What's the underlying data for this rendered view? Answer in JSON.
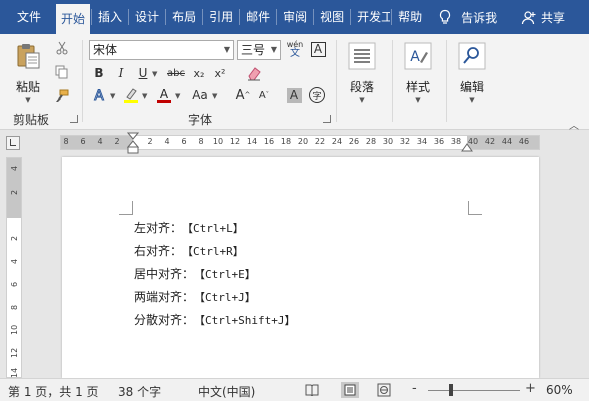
{
  "tabs": [
    {
      "label": "文件"
    },
    {
      "label": "开始",
      "active": true
    },
    {
      "label": "插入"
    },
    {
      "label": "设计"
    },
    {
      "label": "布局"
    },
    {
      "label": "引用"
    },
    {
      "label": "邮件"
    },
    {
      "label": "审阅"
    },
    {
      "label": "视图"
    },
    {
      "label": "开发工"
    },
    {
      "label": "帮助"
    }
  ],
  "tell_me": "告诉我",
  "share": "共享",
  "ribbon": {
    "clipboard": {
      "paste_label": "粘贴",
      "group_label": "剪贴板"
    },
    "font": {
      "font_name": "宋体",
      "font_size": "三号",
      "phonetic_char": "wén",
      "phonetic_sub": "文",
      "border_char": "A",
      "bold": "B",
      "italic": "I",
      "underline": "U",
      "strike": "abc",
      "subscript": "x₂",
      "superscript": "x²",
      "case_label": "Aa",
      "grow": "A",
      "shrink": "A",
      "shade_char": "A",
      "enclose_char": "字",
      "group_label": "字体"
    },
    "paragraph": {
      "label": "段落"
    },
    "styles": {
      "label": "样式"
    },
    "editing": {
      "label": "编辑"
    }
  },
  "ruler": {
    "left_labels": [
      "8",
      "6",
      "4",
      "2"
    ],
    "right_labels": [
      "2",
      "4",
      "6",
      "8",
      "10",
      "12",
      "14",
      "16",
      "18",
      "20",
      "22",
      "24",
      "26",
      "28",
      "30",
      "32",
      "34",
      "36",
      "38",
      "40",
      "42",
      "44",
      "46"
    ],
    "vertical_labels": [
      "4",
      "2",
      "2",
      "4",
      "6",
      "8",
      "10",
      "12",
      "14"
    ]
  },
  "document": {
    "lines": [
      {
        "label": "左对齐：",
        "key": "【Ctrl+L】"
      },
      {
        "label": "右对齐：",
        "key": "【Ctrl+R】"
      },
      {
        "label": "居中对齐：",
        "key": "【Ctrl+E】"
      },
      {
        "label": "两端对齐：",
        "key": "【Ctrl+J】"
      },
      {
        "label": "分散对齐：",
        "key": "【Ctrl+Shift+J】"
      }
    ]
  },
  "status": {
    "page": "第 1 页，共 1 页",
    "words": "38 个字",
    "language": "中文(中国)",
    "zoom_minus": "-",
    "zoom_plus": "+",
    "zoom": "60%"
  },
  "colors": {
    "accent": "#2b579a",
    "highlight": "#ffff00",
    "font_color": "#c00000"
  }
}
